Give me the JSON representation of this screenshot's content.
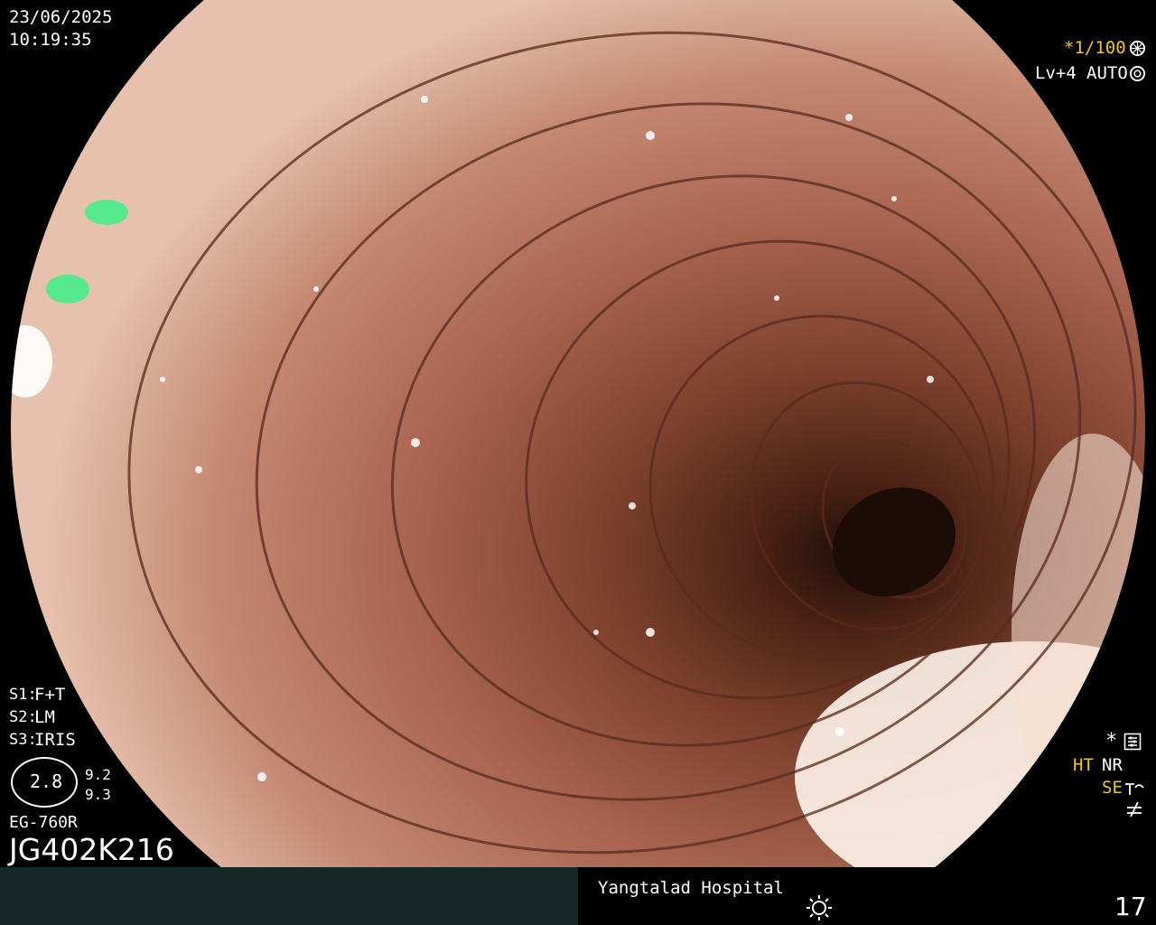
{
  "overlay": {
    "date": "23/06/2025",
    "time": "10:19:35",
    "shutter": "*1/100",
    "level": "Lv+4",
    "mode": "AUTO",
    "s1_key": "S1:",
    "s1_val": "F+T",
    "s2_key": "S2:",
    "s2_val": "LM",
    "s3_key": "S3:",
    "s3_val": "IRIS",
    "zoom_value": "2.8",
    "zoom_side_1": "9.2",
    "zoom_side_2": "9.3",
    "scope_model": "EG-760R",
    "patient_id": "JG402K216",
    "ht": "HT",
    "nr": "NR",
    "se": "SE",
    "star": "*"
  },
  "footer": {
    "hospital": "Yangtalad Hospital",
    "image_number": "17"
  },
  "colors": {
    "overlay_accent": "#f5c518",
    "footer_left_bg": "#142828"
  },
  "icons": [
    "shutter-icon",
    "iris-icon",
    "settings-icon",
    "structure-enhance-icon",
    "color-enhance-icon",
    "brightness-icon"
  ]
}
